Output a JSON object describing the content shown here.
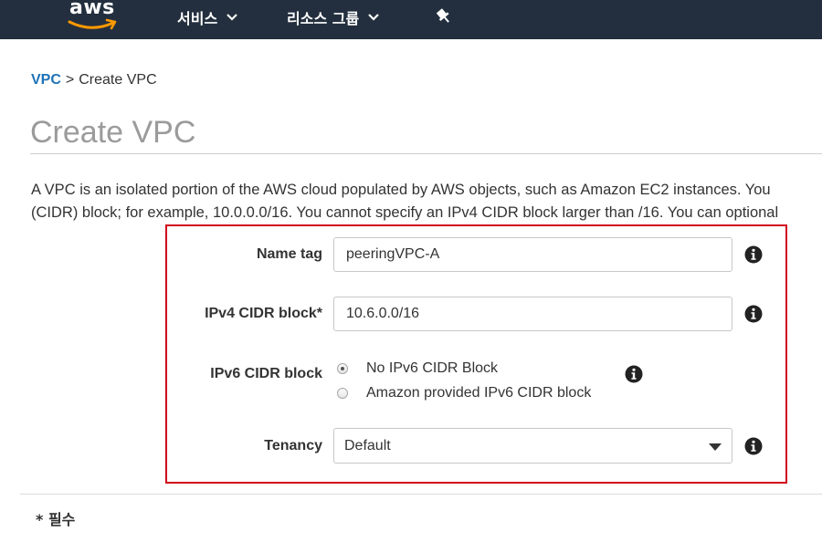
{
  "nav": {
    "logo_text": "aws",
    "services_label": "서비스",
    "resource_groups_label": "리소스 그룹"
  },
  "breadcrumb": {
    "parent": "VPC",
    "separator": ">",
    "current": "Create VPC"
  },
  "page": {
    "title": "Create VPC",
    "description_line1": "A VPC is an isolated portion of the AWS cloud populated by AWS objects, such as Amazon EC2 instances. You",
    "description_line2": "(CIDR) block; for example, 10.0.0.0/16. You cannot specify an IPv4 CIDR block larger than /16. You can optional"
  },
  "form": {
    "name_tag": {
      "label": "Name tag",
      "value": "peeringVPC-A"
    },
    "ipv4_cidr": {
      "label": "IPv4 CIDR block*",
      "value": "10.6.0.0/16"
    },
    "ipv6_cidr": {
      "label": "IPv6 CIDR block",
      "options": [
        "No IPv6 CIDR Block",
        "Amazon provided IPv6 CIDR block"
      ],
      "selected": "No IPv6 CIDR Block"
    },
    "tenancy": {
      "label": "Tenancy",
      "value": "Default"
    }
  },
  "footer": {
    "required_note": "* 필수"
  },
  "colors": {
    "nav_bg": "#232f3e",
    "link_blue": "#1f73b7",
    "highlight_red": "#d0021b",
    "aws_orange": "#ff9900"
  }
}
